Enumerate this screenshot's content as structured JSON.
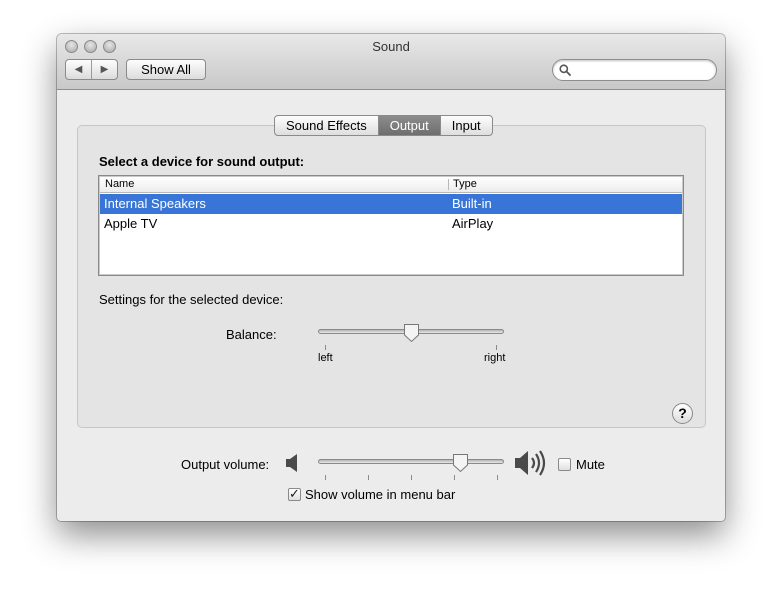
{
  "window": {
    "title": "Sound"
  },
  "toolbar": {
    "back_glyph": "◀",
    "forward_glyph": "▶",
    "show_all_label": "Show All",
    "search": {
      "value": "",
      "placeholder": ""
    }
  },
  "tabs": [
    {
      "label": "Sound Effects",
      "selected": false
    },
    {
      "label": "Output",
      "selected": true
    },
    {
      "label": "Input",
      "selected": false
    }
  ],
  "output": {
    "device_prompt": "Select a device for sound output:",
    "columns": {
      "name": "Name",
      "type": "Type"
    },
    "devices": [
      {
        "name": "Internal Speakers",
        "type": "Built-in",
        "selected": true
      },
      {
        "name": "Apple TV",
        "type": "AirPlay",
        "selected": false
      }
    ],
    "settings_label": "Settings for the selected device:",
    "balance": {
      "label": "Balance:",
      "min_label": "left",
      "max_label": "right",
      "value": 0.5
    }
  },
  "help": {
    "glyph": "?"
  },
  "volume": {
    "label": "Output volume:",
    "value": 0.79,
    "mute_label": "Mute",
    "muted": false,
    "show_in_menu_bar_label": "Show volume in menu bar",
    "show_in_menu_bar": true
  },
  "colors": {
    "selection": "#3875d7",
    "selected_tab": "#7a7a7a"
  }
}
